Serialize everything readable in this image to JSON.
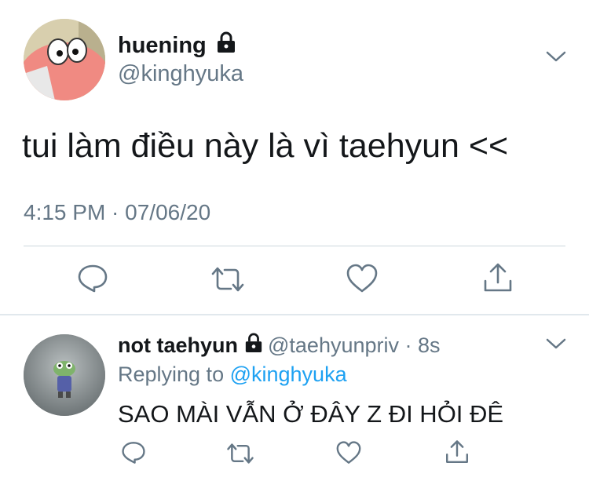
{
  "main_tweet": {
    "display_name": "huening",
    "handle": "@kinghyuka",
    "text": "tui làm điều này là vì taehyun <<",
    "timestamp": "4:15 PM · 07/06/20"
  },
  "reply_tweet": {
    "display_name": "not taehyun",
    "handle": "@taehyunpriv · 8s",
    "replying_prefix": "Replying to ",
    "replying_to": "@kinghyuka",
    "text": "SAO MÀI VẪN Ở ĐÂY Z ĐI HỎI ĐÊ"
  },
  "icons": [
    "lock-icon",
    "chevron-down-icon",
    "reply-icon",
    "retweet-icon",
    "like-icon",
    "share-icon"
  ],
  "colors": {
    "text": "#14171a",
    "secondary": "#657786",
    "link": "#1da1f2",
    "divider": "#ccd6dd"
  }
}
